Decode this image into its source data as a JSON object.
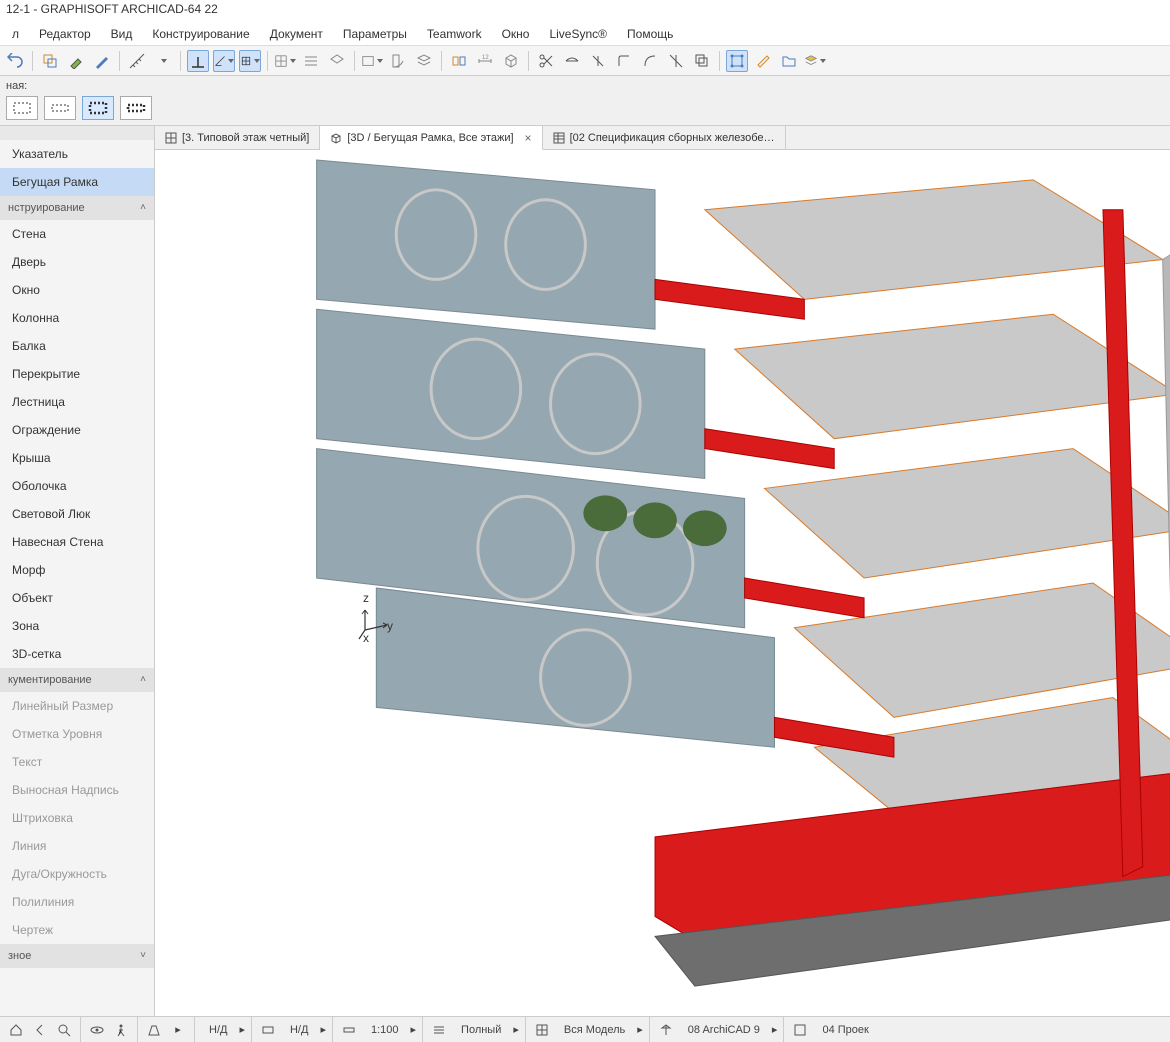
{
  "app": {
    "title": "12-1 - GRAPHISOFT ARCHICAD-64 22"
  },
  "menu": {
    "m0": "л",
    "m1": "Редактор",
    "m2": "Вид",
    "m3": "Конструирование",
    "m4": "Документ",
    "m5": "Параметры",
    "m6": "Teamwork",
    "m7": "Окно",
    "m8": "LiveSync®",
    "m9": "Помощь"
  },
  "secondary": {
    "label": "ная:"
  },
  "sidebar": {
    "items": {
      "s0": "Указатель",
      "s1": "Бегущая Рамка"
    },
    "section_construction": "нструирование",
    "c0": "Стена",
    "c1": "Дверь",
    "c2": "Окно",
    "c3": "Колонна",
    "c4": "Балка",
    "c5": "Перекрытие",
    "c6": "Лестница",
    "c7": "Ограждение",
    "c8": "Крыша",
    "c9": "Оболочка",
    "c10": "Световой Люк",
    "c11": "Навесная Стена",
    "c12": "Морф",
    "c13": "Объект",
    "c14": "Зона",
    "c15": "3D-сетка",
    "section_doc": "кументирование",
    "d0": "Линейный Размер",
    "d1": "Отметка Уровня",
    "d2": "Текст",
    "d3": "Выносная Надпись",
    "d4": "Штриховка",
    "d5": "Линия",
    "d6": "Дуга/Окружность",
    "d7": "Полилиния",
    "d8": "Чертеж",
    "footer": "зное"
  },
  "tabs": {
    "t0": "[3. Типовой этаж четный]",
    "t1": "[3D / Бегущая Рамка, Все этажи]",
    "t2": "[02 Спецификация сборных железобе…"
  },
  "axis": {
    "z": "z",
    "y": "y",
    "x": "x"
  },
  "status": {
    "nd1": "Н/Д",
    "nd2": "Н/Д",
    "scale": "1:100",
    "mode": "Полный",
    "scope": "Вся Модель",
    "layer": "08 ArchiCAD 9",
    "proj": "04 Проек"
  }
}
